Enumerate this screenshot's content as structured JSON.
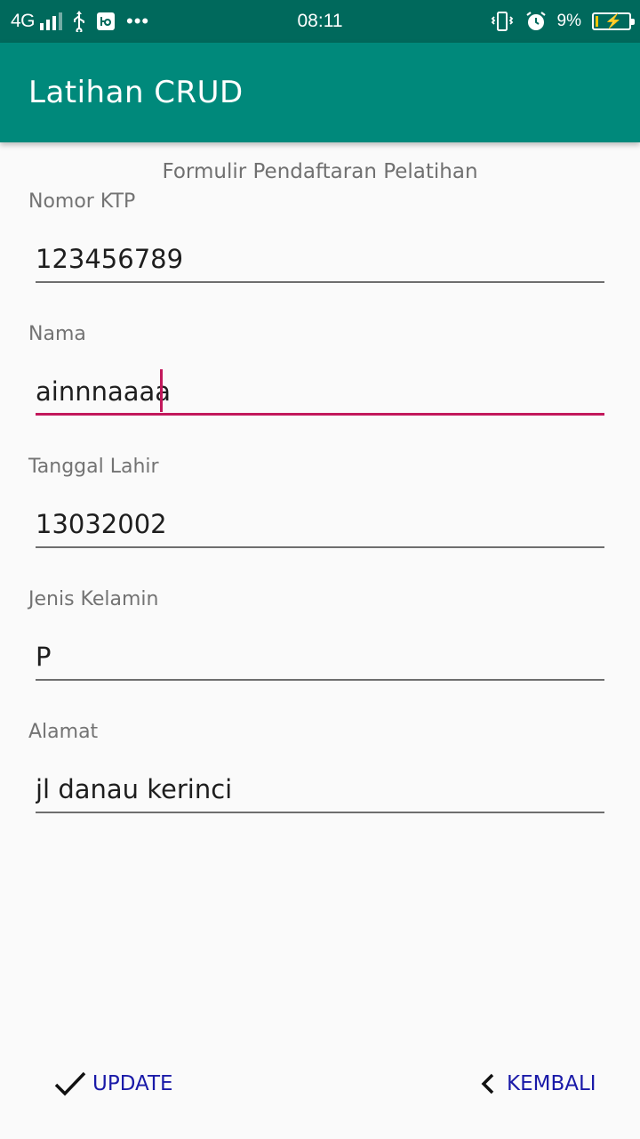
{
  "status_bar": {
    "network": "4G",
    "time": "08:11",
    "battery": "9%",
    "battery_level": 0.09,
    "icons": [
      "signal-icon",
      "usb-icon",
      "notification-icon",
      "more-dots-icon",
      "vibrate-icon",
      "alarm-icon",
      "battery-charging-icon"
    ]
  },
  "app_bar": {
    "title": "Latihan CRUD"
  },
  "form": {
    "heading": "Formulir Pendaftaran Pelatihan",
    "fields": [
      {
        "label": "Nomor KTP",
        "value": "123456789"
      },
      {
        "label": "Nama",
        "value": "ainnnaaaa"
      },
      {
        "label": "Tanggal Lahir",
        "value": "13032002"
      },
      {
        "label": "Jenis Kelamin",
        "value": "P"
      },
      {
        "label": "Alamat",
        "value": "jl danau kerinci"
      }
    ]
  },
  "actions": {
    "update_label": "UPDATE",
    "back_label": "KEMBALI"
  },
  "colors": {
    "status_bar": "#00695c",
    "app_bar": "#00897b",
    "accent": "#c2185b",
    "button_text": "#1a1aa8"
  }
}
